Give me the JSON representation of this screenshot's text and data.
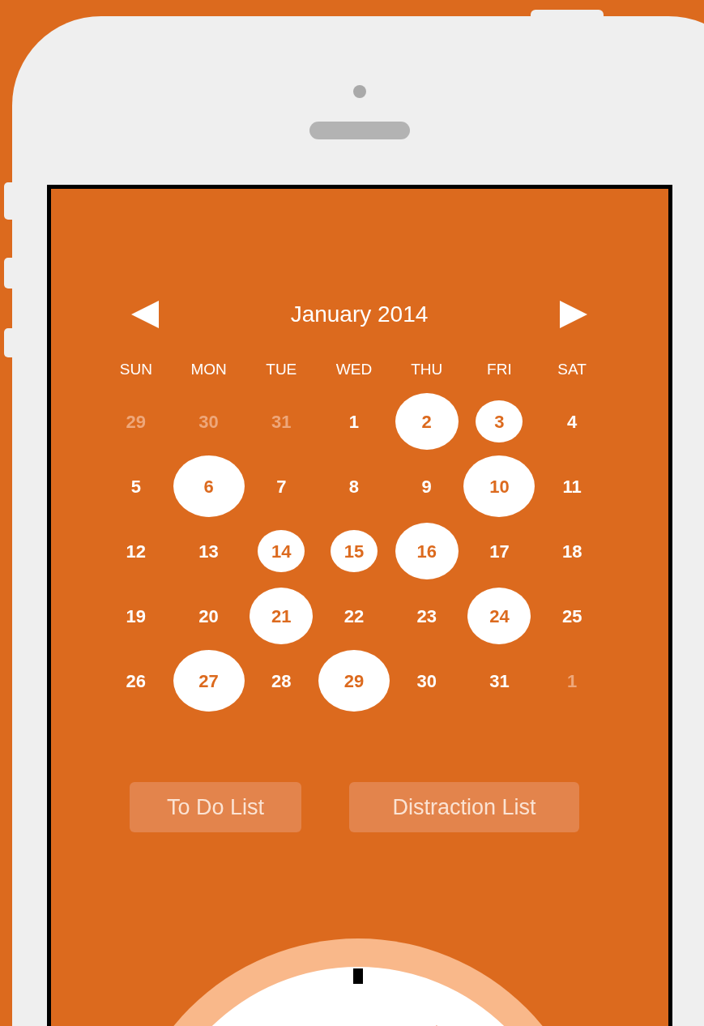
{
  "calendar": {
    "title": "January 2014",
    "weekdays": [
      "SUN",
      "MON",
      "TUE",
      "WED",
      "THU",
      "FRI",
      "SAT"
    ],
    "days": [
      {
        "text": "29",
        "outside_month": true,
        "kind": "plain"
      },
      {
        "text": "30",
        "outside_month": true,
        "kind": "plain"
      },
      {
        "text": "31",
        "outside_month": true,
        "kind": "plain"
      },
      {
        "text": "1",
        "outside_month": false,
        "kind": "plain"
      },
      {
        "text": "2",
        "outside_month": false,
        "kind": "medium"
      },
      {
        "text": "3",
        "outside_month": false,
        "kind": "small"
      },
      {
        "text": "4",
        "outside_month": false,
        "kind": "plain"
      },
      {
        "text": "5",
        "outside_month": false,
        "kind": "plain"
      },
      {
        "text": "6",
        "outside_month": false,
        "kind": "large"
      },
      {
        "text": "7",
        "outside_month": false,
        "kind": "plain"
      },
      {
        "text": "8",
        "outside_month": false,
        "kind": "plain"
      },
      {
        "text": "9",
        "outside_month": false,
        "kind": "plain"
      },
      {
        "text": "10",
        "outside_month": false,
        "kind": "large"
      },
      {
        "text": "11",
        "outside_month": false,
        "kind": "plain"
      },
      {
        "text": "12",
        "outside_month": false,
        "kind": "plain"
      },
      {
        "text": "13",
        "outside_month": false,
        "kind": "plain"
      },
      {
        "text": "14",
        "outside_month": false,
        "kind": "small"
      },
      {
        "text": "15",
        "outside_month": false,
        "kind": "small"
      },
      {
        "text": "16",
        "outside_month": false,
        "kind": "medium"
      },
      {
        "text": "17",
        "outside_month": false,
        "kind": "plain"
      },
      {
        "text": "18",
        "outside_month": false,
        "kind": "plain"
      },
      {
        "text": "19",
        "outside_month": false,
        "kind": "plain"
      },
      {
        "text": "20",
        "outside_month": false,
        "kind": "plain"
      },
      {
        "text": "21",
        "outside_month": false,
        "kind": "medium"
      },
      {
        "text": "22",
        "outside_month": false,
        "kind": "plain"
      },
      {
        "text": "23",
        "outside_month": false,
        "kind": "plain"
      },
      {
        "text": "24",
        "outside_month": false,
        "kind": "medium"
      },
      {
        "text": "25",
        "outside_month": false,
        "kind": "plain"
      },
      {
        "text": "26",
        "outside_month": false,
        "kind": "plain"
      },
      {
        "text": "27",
        "outside_month": false,
        "kind": "large"
      },
      {
        "text": "28",
        "outside_month": false,
        "kind": "plain"
      },
      {
        "text": "29",
        "outside_month": false,
        "kind": "large"
      },
      {
        "text": "30",
        "outside_month": false,
        "kind": "plain"
      },
      {
        "text": "31",
        "outside_month": false,
        "kind": "plain"
      },
      {
        "text": "1",
        "outside_month": true,
        "kind": "plain"
      }
    ]
  },
  "buttons": [
    "To Do List",
    "Distraction List"
  ]
}
